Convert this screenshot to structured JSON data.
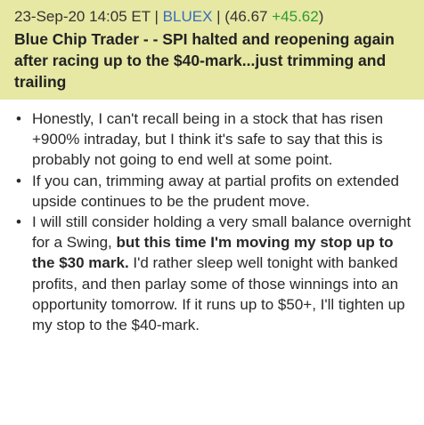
{
  "header": {
    "timestamp": "23-Sep-20 14:05 ET",
    "separator_1": " | ",
    "ticker": "BLUEX",
    "separator_2": " | ",
    "price_open": "(46.67",
    "price_change": "+45.62",
    "price_close": ")",
    "title": "Blue Chip Trader - - SPI halted and reopening again after racing up to the $40-mark...just trimming and trailing"
  },
  "bullets": [
    {
      "text": "Honestly, I can't recall being in a stock that has risen +900% intraday, but I think it's safe to say that this is probably not going to end well at some point."
    },
    {
      "text": "If you can, trimming away at partial profits on extended upside continues to be the prudent move."
    },
    {
      "text_before": "I will still consider holding a very small balance overnight for a Swing, ",
      "text_bold": "but this time I'm moving my stop up to the $30 mark.",
      "text_after": "  I'd rather sleep well tonight with banked profits, and then parlay some of those winnings into an opportunity tomorrow. If it runs up to $50+, I'll tighten up my stop to the $40-mark."
    }
  ],
  "colors": {
    "header_bg": "#e6e8a4",
    "ticker": "#3a6bbf",
    "change": "#2e9a2e"
  }
}
